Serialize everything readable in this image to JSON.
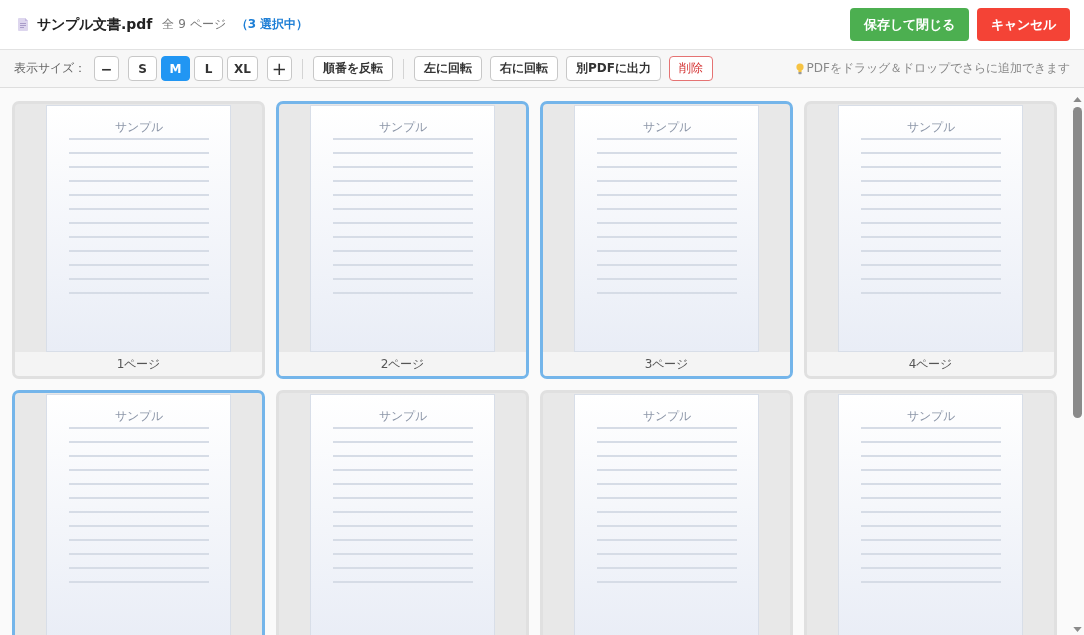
{
  "header": {
    "file_name": "サンプル文書.pdf",
    "page_count": "全 9 ページ",
    "selection_count": "（3 選択中）",
    "buttons": [
      {
        "label": "保存して閉じる",
        "kind": "primary"
      },
      {
        "label": "キャンセル",
        "kind": "danger"
      }
    ]
  },
  "toolbar": {
    "size_label": "表示サイズ：",
    "size_decrease": "−",
    "sizes": [
      {
        "label": "S",
        "selected": false
      },
      {
        "label": "M",
        "selected": true
      },
      {
        "label": "L",
        "selected": false
      },
      {
        "label": "XL",
        "selected": false
      }
    ],
    "size_increase": "+",
    "action_groups": [
      [
        {
          "label": "順番を反転",
          "kind": "normal"
        }
      ],
      [
        {
          "label": "左に回転",
          "kind": "normal"
        },
        {
          "label": "右に回転",
          "kind": "normal"
        },
        {
          "label": "別PDFに出力",
          "kind": "normal"
        },
        {
          "label": "削除",
          "kind": "danger"
        }
      ]
    ],
    "hint": "PDFをドラッグ＆ドロップでさらに追加できます"
  },
  "pages": [
    {
      "heading": "サンプル",
      "label": "1ページ",
      "selected": false
    },
    {
      "heading": "サンプル",
      "label": "2ページ",
      "selected": true
    },
    {
      "heading": "サンプル",
      "label": "3ページ",
      "selected": true
    },
    {
      "heading": "サンプル",
      "label": "4ページ",
      "selected": false
    },
    {
      "heading": "サンプル",
      "selected": true
    },
    {
      "heading": "サンプル",
      "selected": false
    },
    {
      "heading": "サンプル",
      "selected": false
    },
    {
      "heading": "サンプル",
      "selected": false
    }
  ]
}
